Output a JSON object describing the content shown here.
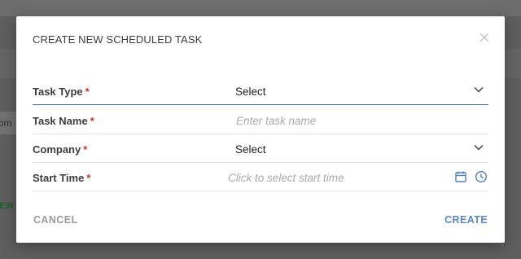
{
  "background": {
    "tab_fragment": "rom",
    "link_fragment": "IEW"
  },
  "dialog": {
    "title": "CREATE NEW SCHEDULED TASK",
    "close_icon": "close-icon",
    "fields": [
      {
        "label": "Task Type",
        "required_mark": "*",
        "value": "Select",
        "kind": "select"
      },
      {
        "label": "Task Name",
        "required_mark": "*",
        "placeholder": "Enter task name",
        "kind": "text"
      },
      {
        "label": "Company",
        "required_mark": "*",
        "value": "Select",
        "kind": "select"
      },
      {
        "label": "Start Time",
        "required_mark": "*",
        "placeholder": "Click to select start time",
        "kind": "datetime"
      }
    ],
    "cancel_label": "CANCEL",
    "create_label": "CREATE"
  },
  "colors": {
    "accent": "#5a88c4",
    "active_underline": "#3f6ea3",
    "required": "#c0392b",
    "overlay": "#5f5f5f"
  }
}
